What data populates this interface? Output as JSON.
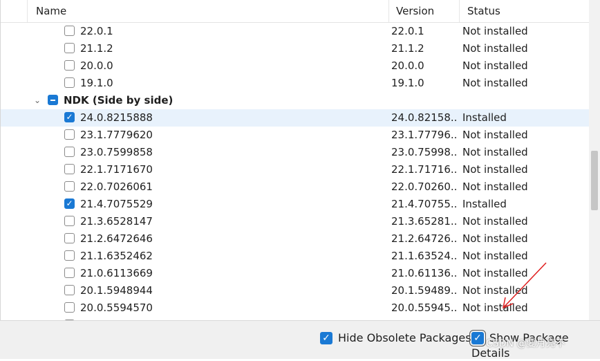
{
  "header": {
    "name": "Name",
    "version": "Version",
    "status": "Status"
  },
  "rows": [
    {
      "name": "22.0.1",
      "version": "22.0.1",
      "status": "Not installed",
      "checked": false
    },
    {
      "name": "21.1.2",
      "version": "21.1.2",
      "status": "Not installed",
      "checked": false
    },
    {
      "name": "20.0.0",
      "version": "20.0.0",
      "status": "Not installed",
      "checked": false
    },
    {
      "name": "19.1.0",
      "version": "19.1.0",
      "status": "Not installed",
      "checked": false
    },
    {
      "name": "NDK (Side by side)",
      "group": true,
      "state": "indeterminate",
      "expanded": true
    },
    {
      "name": "24.0.8215888",
      "version": "24.0.82158...",
      "status": "Installed",
      "checked": true,
      "selected": true
    },
    {
      "name": "23.1.7779620",
      "version": "23.1.77796...",
      "status": "Not installed",
      "checked": false
    },
    {
      "name": "23.0.7599858",
      "version": "23.0.75998...",
      "status": "Not installed",
      "checked": false
    },
    {
      "name": "22.1.7171670",
      "version": "22.1.71716...",
      "status": "Not installed",
      "checked": false
    },
    {
      "name": "22.0.7026061",
      "version": "22.0.70260...",
      "status": "Not installed",
      "checked": false
    },
    {
      "name": "21.4.7075529",
      "version": "21.4.70755...",
      "status": "Installed",
      "checked": true
    },
    {
      "name": "21.3.6528147",
      "version": "21.3.65281...",
      "status": "Not installed",
      "checked": false
    },
    {
      "name": "21.2.6472646",
      "version": "21.2.64726...",
      "status": "Not installed",
      "checked": false
    },
    {
      "name": "21.1.6352462",
      "version": "21.1.63524...",
      "status": "Not installed",
      "checked": false
    },
    {
      "name": "21.0.6113669",
      "version": "21.0.61136...",
      "status": "Not installed",
      "checked": false
    },
    {
      "name": "20.1.5948944",
      "version": "20.1.59489...",
      "status": "Not installed",
      "checked": false
    },
    {
      "name": "20.0.5594570",
      "version": "20.0.55945...",
      "status": "Not installed",
      "checked": false
    }
  ],
  "footer": {
    "hide_obsolete_label": "Hide Obsolete Packages",
    "hide_obsolete_checked": true,
    "show_details_label": "Show Package Details",
    "show_details_checked": true
  },
  "watermark": "CSDN @要月亮不",
  "colors": {
    "accent": "#1a79d4",
    "selected_row": "#e8f2fc",
    "annotation_arrow": "#e02020"
  },
  "icons": {
    "checkbox_checked": "checkmark",
    "expander": "chevron-down-icon"
  }
}
